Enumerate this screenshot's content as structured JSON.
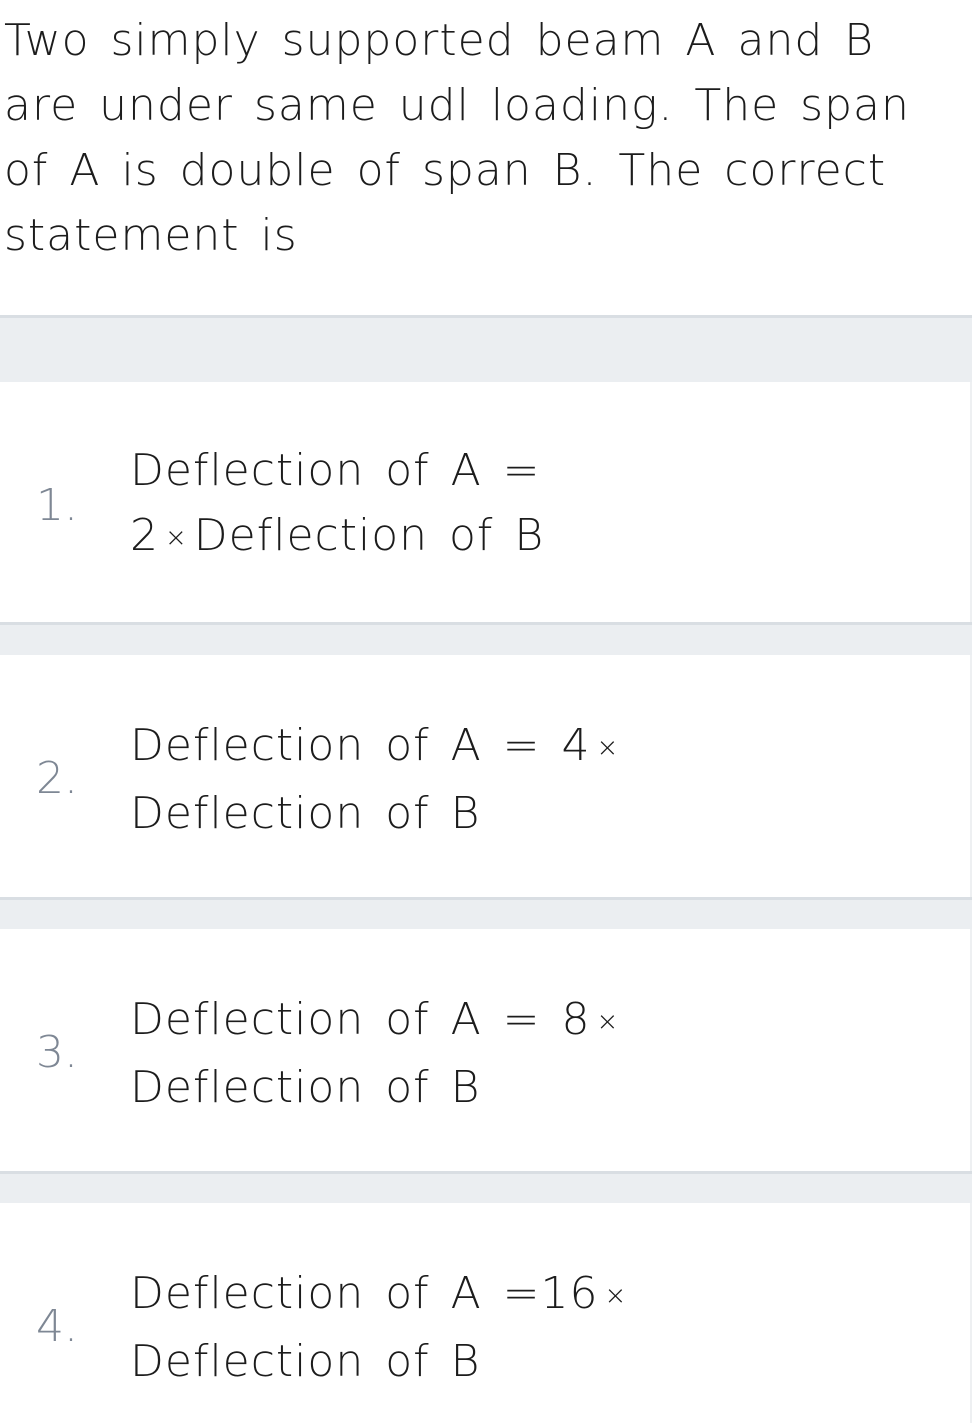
{
  "question": {
    "text": "Two simply supported beam A and B are under same udl loading. The span of A is double of span B. The correct statement is"
  },
  "options": [
    {
      "number": "1.",
      "line1": "Deflection of A =",
      "line2_prefix": "2",
      "times_symbol": "×",
      "line2_suffix": "Deflection of B"
    },
    {
      "number": "2.",
      "line1": "Deflection of A = 4",
      "times_symbol": "×",
      "line2": "Deflection of B"
    },
    {
      "number": "3.",
      "line1": "Deflection of A = 8",
      "times_symbol": "×",
      "line2": "Deflection of B"
    },
    {
      "number": "4.",
      "line1": "Deflection of A =16",
      "times_symbol": "×",
      "line2": "Deflection of B"
    }
  ],
  "colors": {
    "separator_fill": "#ebeef1",
    "separator_line": "#d9dee3",
    "option_number": "#7e8794",
    "text": "#1c1c1c",
    "background": "#ffffff"
  }
}
